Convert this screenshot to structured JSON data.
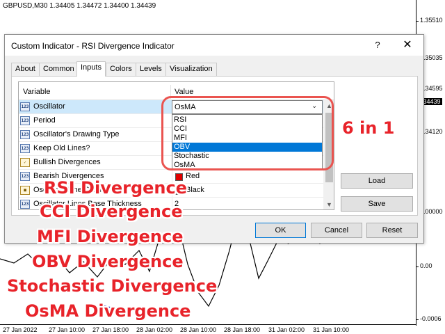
{
  "chart": {
    "title": "GBPUSD,M30  1.34405 1.34472 1.34400 1.34439",
    "price_labels": [
      "1.35510",
      "1.35035",
      "1.34595",
      "1.34439",
      "1.34120",
      "0.00000",
      "0.00",
      "-0.0006"
    ],
    "current_price": "1.34439",
    "time_labels": [
      "27 Jan 2022",
      "27 Jan 10:00",
      "27 Jan 18:00",
      "28 Jan 02:00",
      "28 Jan 10:00",
      "28 Jan 18:00",
      "31 Jan 02:00",
      "31 Jan 10:00"
    ]
  },
  "dialog": {
    "title": "Custom Indicator - RSI Divergence Indicator",
    "help": "?",
    "close": "✕",
    "tabs": [
      {
        "label": "About"
      },
      {
        "label": "Common"
      },
      {
        "label": "Inputs"
      },
      {
        "label": "Colors"
      },
      {
        "label": "Levels"
      },
      {
        "label": "Visualization"
      }
    ],
    "active_tab": "Inputs",
    "grid": {
      "col_variable": "Variable",
      "col_value": "Value",
      "rows": [
        {
          "name": "Oscillator",
          "value": "OsMA",
          "icon": "123"
        },
        {
          "name": "Period",
          "value": "",
          "icon": "123"
        },
        {
          "name": "Oscillator's Drawing Type",
          "value": "",
          "icon": "123"
        },
        {
          "name": "Keep Old Lines?",
          "value": "",
          "icon": "123"
        },
        {
          "name": "Bullish Divergences",
          "value": "",
          "icon": "bool"
        },
        {
          "name": "Bearish Divergences",
          "value": "Red",
          "icon": "123",
          "swatch": "#e00000"
        },
        {
          "name": "Oscillator Line Color",
          "value": "Black",
          "icon": "bool",
          "swatch": "#000000"
        },
        {
          "name": "Oscillator Lines Base Thickness",
          "value": "2",
          "icon": "123"
        }
      ]
    },
    "dropdown": {
      "selected": "OsMA",
      "options": [
        "RSI",
        "CCI",
        "MFI",
        "OBV",
        "Stochastic",
        "OsMA"
      ],
      "highlighted": "OBV"
    },
    "buttons": {
      "load": "Load",
      "save": "Save",
      "ok": "OK",
      "cancel": "Cancel",
      "reset": "Reset"
    }
  },
  "overlay": {
    "six_in_one": "6 in 1",
    "divergences": [
      "RSI Divergence",
      "CCI Divergence",
      "MFI Divergence",
      "OBV Divergence",
      "Stochastic Divergence",
      "OsMA Divergence"
    ],
    "accent_color": "#e8232a"
  }
}
